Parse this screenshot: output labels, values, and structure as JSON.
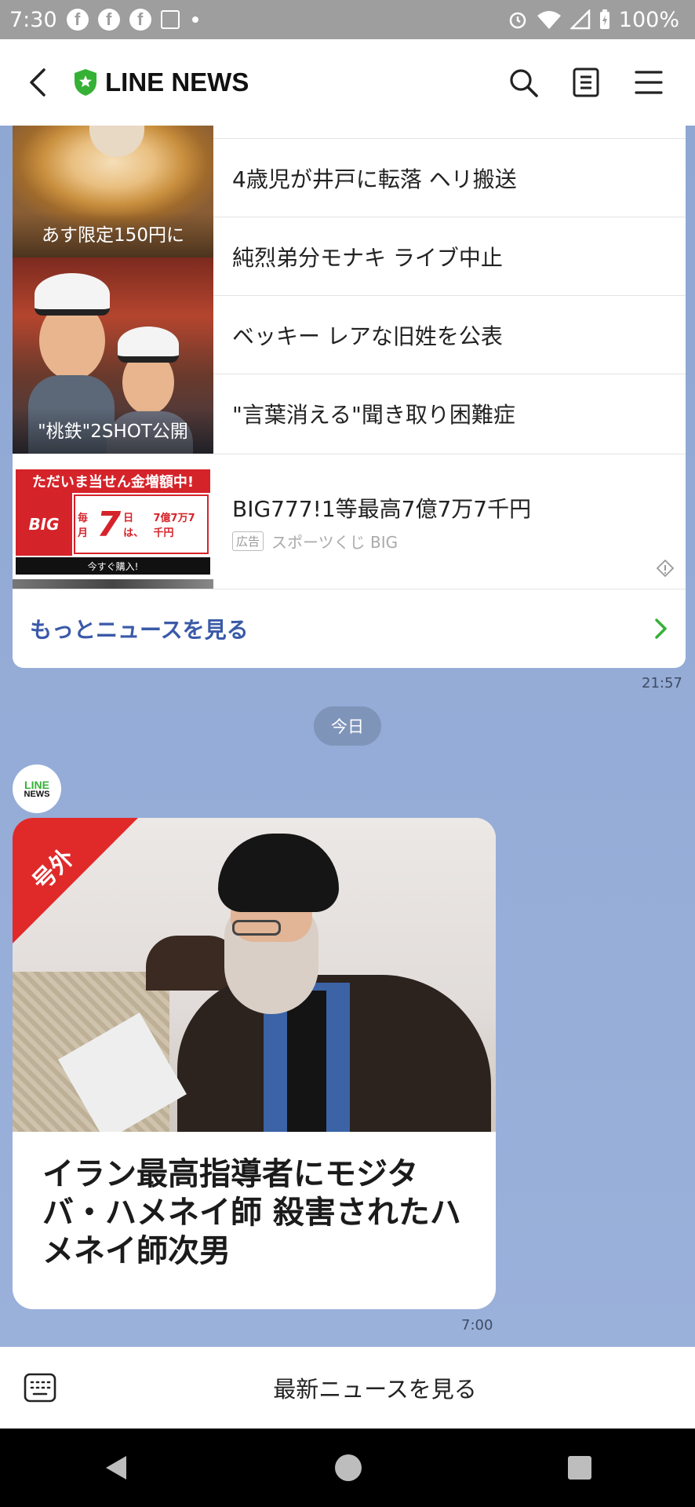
{
  "status_bar": {
    "time": "7:30",
    "notif_icons": [
      "facebook-icon",
      "facebook-icon",
      "facebook-icon",
      "news-icon"
    ],
    "battery": "100%"
  },
  "header": {
    "title": "LINE NEWS",
    "icons": [
      "back-icon",
      "shield-logo-icon",
      "search-icon",
      "document-icon",
      "menu-icon"
    ]
  },
  "news_card": {
    "thumbnails": [
      {
        "caption": "あす限定150円に"
      },
      {
        "caption": "\"桃鉄\"2SHOT公開"
      }
    ],
    "ad_image": {
      "top": "ただいま当せん金増額中!",
      "logo": "BIG",
      "prefix": "毎月",
      "number": "7",
      "day": "日は、",
      "amount": "7億7万7千円",
      "bottom": "今すぐ購入!"
    },
    "items": [
      {
        "title": "4歳児が井戸に転落 ヘリ搬送"
      },
      {
        "title": "純烈弟分モナキ ライブ中止"
      },
      {
        "title": "ベッキー レアな旧姓を公表"
      },
      {
        "title": "\"言葉消える\"聞き取り困難症"
      }
    ],
    "ad": {
      "title": "BIG777!1等最高7億7万7千円",
      "tag": "広告",
      "sponsor": "スポーツくじ BIG"
    },
    "more_label": "もっとニュースを見る",
    "timestamp": "21:57"
  },
  "date_divider": "今日",
  "sender": {
    "line1": "LINE",
    "line2": "NEWS"
  },
  "main_card": {
    "ribbon": "号外",
    "headline": "イラン最高指導者にモジタバ・ハメネイ師 殺害されたハメネイ師次男",
    "timestamp": "7:00"
  },
  "bottom_bar": {
    "label": "最新ニュースを見る"
  },
  "colors": {
    "brand_green": "#35b135",
    "link_blue": "#3a5aa8",
    "ribbon_red": "#e02a2a",
    "chat_bg": "#8fa8d4"
  }
}
